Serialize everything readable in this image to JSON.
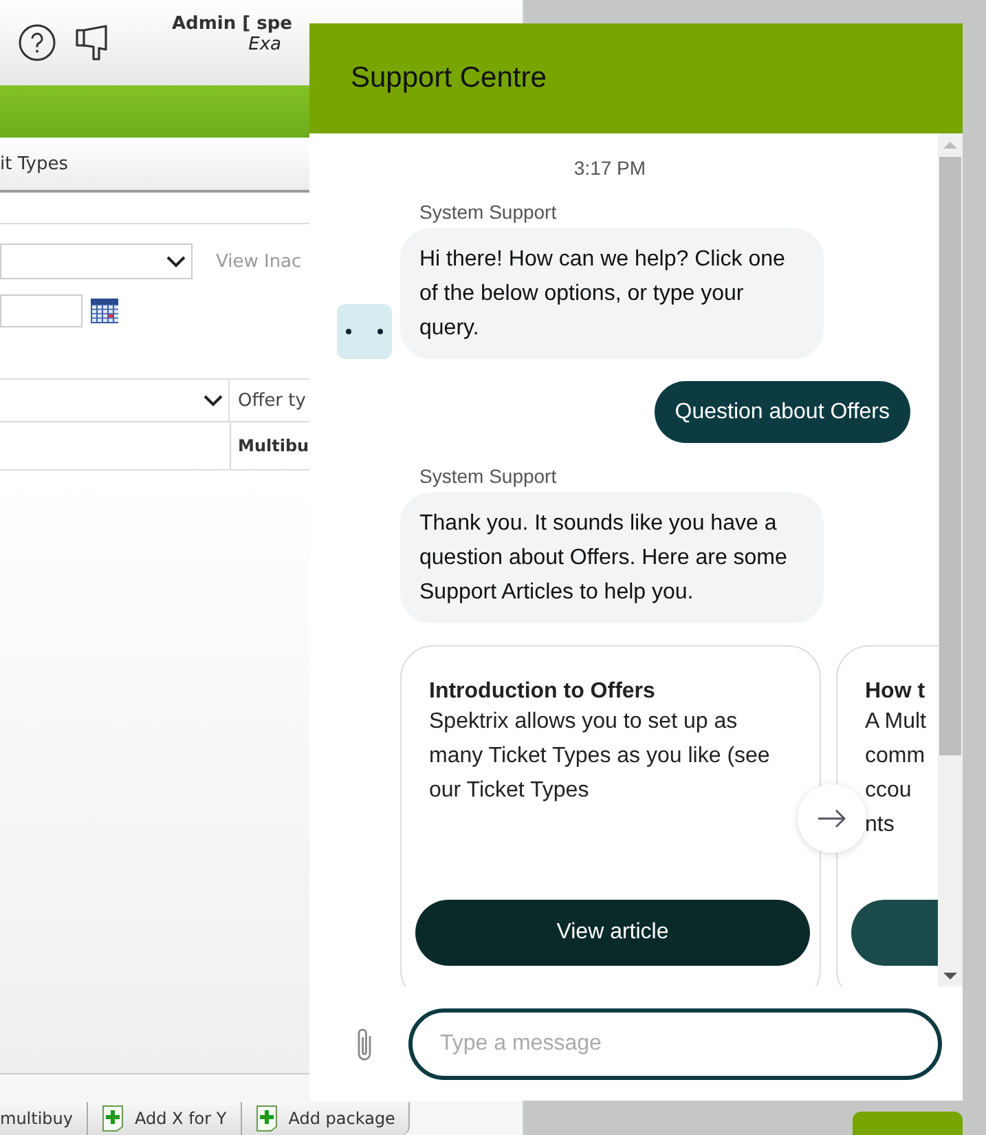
{
  "background_app": {
    "user_label": "Admin [ spe",
    "subtitle": "Exa",
    "tab": "it Types",
    "filter_link": "View Inac",
    "table": {
      "column_2": "Offer ty",
      "rows": [
        {
          "column_2": "Multibu"
        }
      ]
    },
    "toolbar": [
      {
        "label": "multibuy",
        "icon": false
      },
      {
        "label": "Add X for Y",
        "icon": true
      },
      {
        "label": "Add package",
        "icon": true
      }
    ]
  },
  "chat": {
    "title": "Support Centre",
    "timestamp": "3:17 PM",
    "messages": [
      {
        "kind": "bot",
        "sender": "System Support",
        "text": "Hi there! How can we help? Click one of the below options, or type your query.",
        "avatar": true
      },
      {
        "kind": "user",
        "text": "Question about Offers"
      },
      {
        "kind": "bot",
        "sender": "System Support",
        "text": "Thank you. It sounds like you have a question about Offers. Here are some Support Articles to help you.",
        "avatar": false
      },
      {
        "kind": "cards",
        "cards": [
          {
            "title": "Introduction to Offers",
            "body": [
              "Spektrix allows you to set up as",
              "many Ticket Types as you like (see",
              "our Ticket Types"
            ],
            "button": "View article"
          },
          {
            "title": "How t",
            "body": [
              "A Mult",
              "comm",
              "ccou",
              "nts"
            ]
          }
        ]
      }
    ],
    "input": {
      "placeholder": "Type a message"
    }
  }
}
